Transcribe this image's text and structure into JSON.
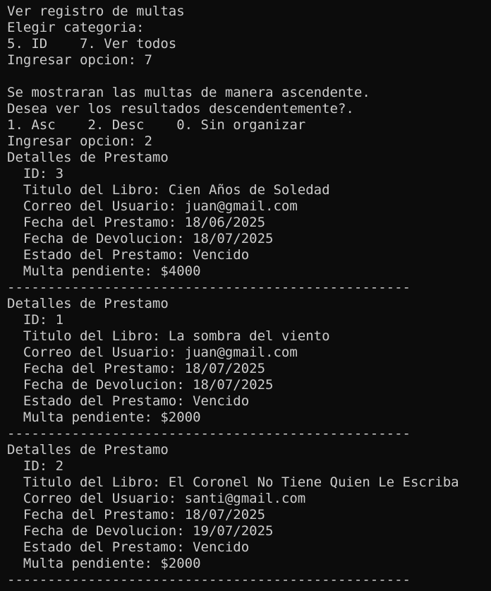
{
  "terminal": {
    "lines": [
      "Ver registro de multas",
      "Elegir categoria:",
      "5. ID    7. Ver todos",
      "Ingresar opcion: 7",
      "",
      "Se mostraran las multas de manera ascendente.",
      "Desea ver los resultados descendentemente?.",
      "1. Asc    2. Desc    0. Sin organizar",
      "Ingresar opcion: 2",
      "Detalles de Prestamo",
      "  ID: 3",
      "  Titulo del Libro: Cien Años de Soledad",
      "  Correo del Usuario: juan@gmail.com",
      "  Fecha del Prestamo: 18/06/2025",
      "  Fecha de Devolucion: 18/07/2025",
      "  Estado del Prestamo: Vencido",
      "  Multa pendiente: $4000",
      "--------------------------------------------------",
      "Detalles de Prestamo",
      "  ID: 1",
      "  Titulo del Libro: La sombra del viento",
      "  Correo del Usuario: juan@gmail.com",
      "  Fecha del Prestamo: 18/07/2025",
      "  Fecha de Devolucion: 18/07/2025",
      "  Estado del Prestamo: Vencido",
      "  Multa pendiente: $2000",
      "--------------------------------------------------",
      "Detalles de Prestamo",
      "  ID: 2",
      "  Titulo del Libro: El Coronel No Tiene Quien Le Escriba",
      "  Correo del Usuario: santi@gmail.com",
      "  Fecha del Prestamo: 18/07/2025",
      "  Fecha de Devolucion: 19/07/2025",
      "  Estado del Prestamo: Vencido",
      "  Multa pendiente: $2000",
      "--------------------------------------------------"
    ],
    "colors": {
      "background": "#0c0c0c",
      "foreground": "#cccccc"
    }
  }
}
